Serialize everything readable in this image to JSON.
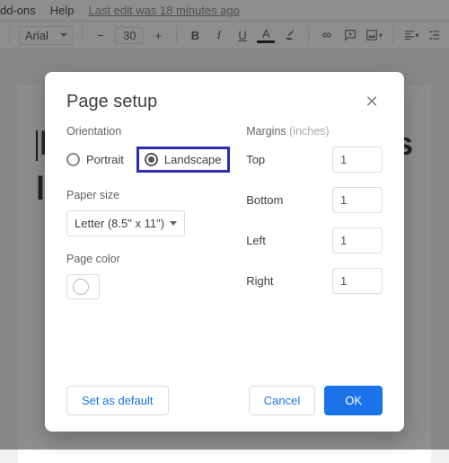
{
  "menu": {
    "addons": "dd-ons",
    "help": "Help",
    "last_edit": "Last edit was 18 minutes ago"
  },
  "toolbar": {
    "font": "Arial",
    "size": "30"
  },
  "doc": {
    "line1": "h",
    "line1b": "ocs",
    "line2": "la"
  },
  "dialog": {
    "title": "Page setup",
    "orientation": {
      "label": "Orientation",
      "portrait": "Portrait",
      "landscape": "Landscape"
    },
    "paper": {
      "label": "Paper size",
      "value": "Letter (8.5\" x 11\")"
    },
    "color": {
      "label": "Page color"
    },
    "margins": {
      "label": "Margins",
      "units": "(inches)",
      "top": {
        "label": "Top",
        "value": "1"
      },
      "bottom": {
        "label": "Bottom",
        "value": "1"
      },
      "left": {
        "label": "Left",
        "value": "1"
      },
      "right": {
        "label": "Right",
        "value": "1"
      }
    },
    "buttons": {
      "default": "Set as default",
      "cancel": "Cancel",
      "ok": "OK"
    }
  }
}
